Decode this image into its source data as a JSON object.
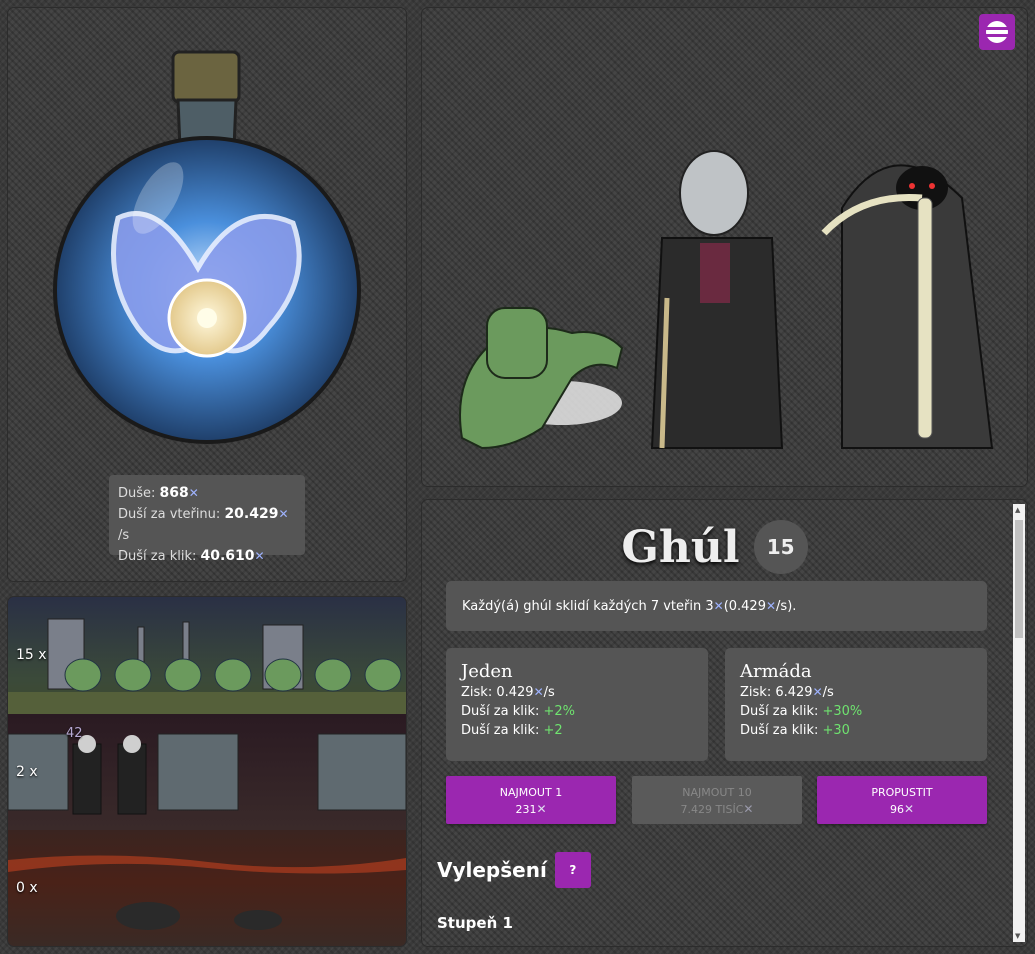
{
  "stats": {
    "souls_label": "Duše:",
    "souls_value": "868",
    "per_second_label": "Duší za vteřinu:",
    "per_second_value": "20.429",
    "per_second_unit": "/s",
    "per_click_label": "Duší za klik:",
    "per_click_value": "40.610"
  },
  "world": {
    "rows": [
      {
        "count": "15 x",
        "theme": "graveyard"
      },
      {
        "count": "2 x",
        "theme": "mansion"
      },
      {
        "count": "0 x",
        "theme": "underworld"
      }
    ],
    "floating_number": "42"
  },
  "unit": {
    "name": "Ghúl",
    "level": "15",
    "description_parts": [
      "Každý(á) ghúl sklidí každých 7 vteřin 3",
      " (0.429 ",
      "/s)."
    ],
    "single": {
      "title": "Jeden",
      "gain_label": "Zisk:",
      "gain_value": "0.429",
      "gain_unit": "/s",
      "click_pct_label": "Duší za klik:",
      "click_pct_value": "+2%",
      "click_label": "Duší za klik:",
      "click_value": "+2"
    },
    "army": {
      "title": "Armáda",
      "gain_label": "Zisk:",
      "gain_value": "6.429",
      "gain_unit": "/s",
      "click_pct_label": "Duší za klik:",
      "click_pct_value": "+30%",
      "click_label": "Duší za klik:",
      "click_value": "+30"
    },
    "buttons": {
      "hire1_label": "NAJMOUT 1",
      "hire1_cost": "231",
      "hire10_label": "NAJMOUT 10",
      "hire10_cost": "7.429 TISÍC",
      "release_label": "PROPUSTIT",
      "release_cost": "96"
    },
    "upgrades_title": "Vylepšení",
    "upgrades_help": "?",
    "tier_label": "Stupeň 1"
  },
  "colors": {
    "accent": "#9b27b0",
    "positive": "#6fe36f",
    "soul": "#9fb3ff"
  },
  "icons": {
    "soul": "butterfly-icon",
    "menu": "menu-icon"
  }
}
